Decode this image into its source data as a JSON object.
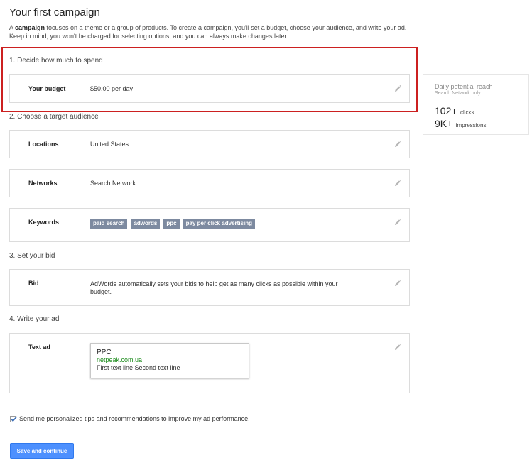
{
  "page": {
    "title": "Your first campaign",
    "intro_prefix": "A ",
    "intro_bold": "campaign",
    "intro_rest": " focuses on a theme or a group of products. To create a campaign, you'll set a budget, choose your audience, and write your ad. Keep in mind, you won't be charged for selecting options, and you can always make changes later."
  },
  "sections": {
    "spend": {
      "heading": "1. Decide how much to spend"
    },
    "audience": {
      "heading": "2. Choose a target audience"
    },
    "bid": {
      "heading": "3. Set your bid"
    },
    "ad": {
      "heading": "4. Write your ad"
    }
  },
  "budget": {
    "label": "Your budget",
    "value": "$50.00 per day"
  },
  "locations": {
    "label": "Locations",
    "value": "United States"
  },
  "networks": {
    "label": "Networks",
    "value": "Search Network"
  },
  "keywords": {
    "label": "Keywords",
    "tags": [
      "paid search",
      "adwords",
      "ppc",
      "pay per click advertising"
    ]
  },
  "bid": {
    "label": "Bid",
    "value": "AdWords automatically sets your bids to help get as many clicks as possible within your budget."
  },
  "text_ad": {
    "label": "Text ad",
    "headline": "PPC",
    "display_url": "netpeak.com.ua",
    "description": "First text line Second text line"
  },
  "reach": {
    "title": "Daily potential reach",
    "subtitle": "Search Network only",
    "clicks_value": "102+",
    "clicks_unit": "clicks",
    "impressions_value": "9K+",
    "impressions_unit": "impressions"
  },
  "tips": {
    "label": "Send me personalized tips and recommendations to improve my ad performance.",
    "checked": true
  },
  "actions": {
    "save_label": "Save and continue"
  },
  "colors": {
    "highlight_border": "#cc2020",
    "tag_bg": "#7d8aa0",
    "button_bg": "#4d90fe",
    "ad_url": "#1a8a1a"
  },
  "icons": {
    "edit": "pencil-icon",
    "checkbox": "check-icon"
  }
}
